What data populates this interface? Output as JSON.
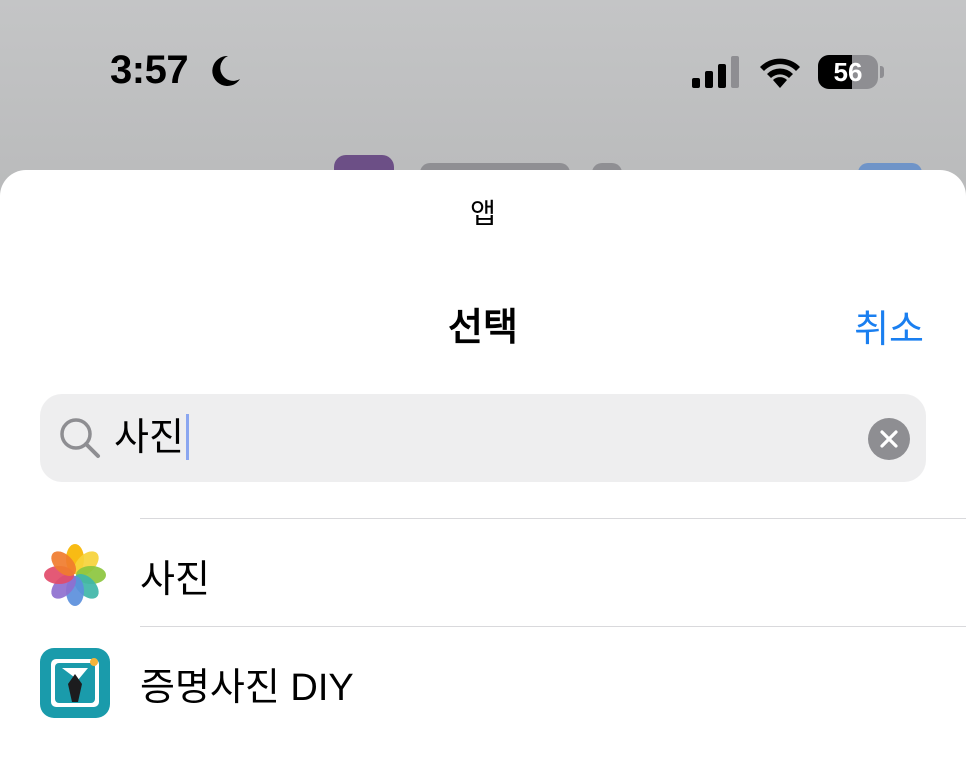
{
  "status_bar": {
    "time": "3:57",
    "battery": "56",
    "battery_level": 0.56,
    "icons": [
      "moon-icon",
      "signal-icon",
      "wifi-icon",
      "battery-icon"
    ]
  },
  "sheet": {
    "caption": "앱",
    "title": "선택",
    "cancel_label": "취소"
  },
  "search": {
    "value": "사진",
    "icon": "search-icon",
    "clear_icon": "clear-icon"
  },
  "results": [
    {
      "label": "사진",
      "icon": "photos-app-icon"
    },
    {
      "label": "증명사진 DIY",
      "icon": "id-photo-diy-app-icon"
    }
  ],
  "colors": {
    "accent": "#1a7ff0",
    "search_bg": "#eeeeef",
    "backdrop": "#c0c1c2",
    "divider": "#d9d9dc",
    "id_photo_teal": "#1a9bab"
  }
}
